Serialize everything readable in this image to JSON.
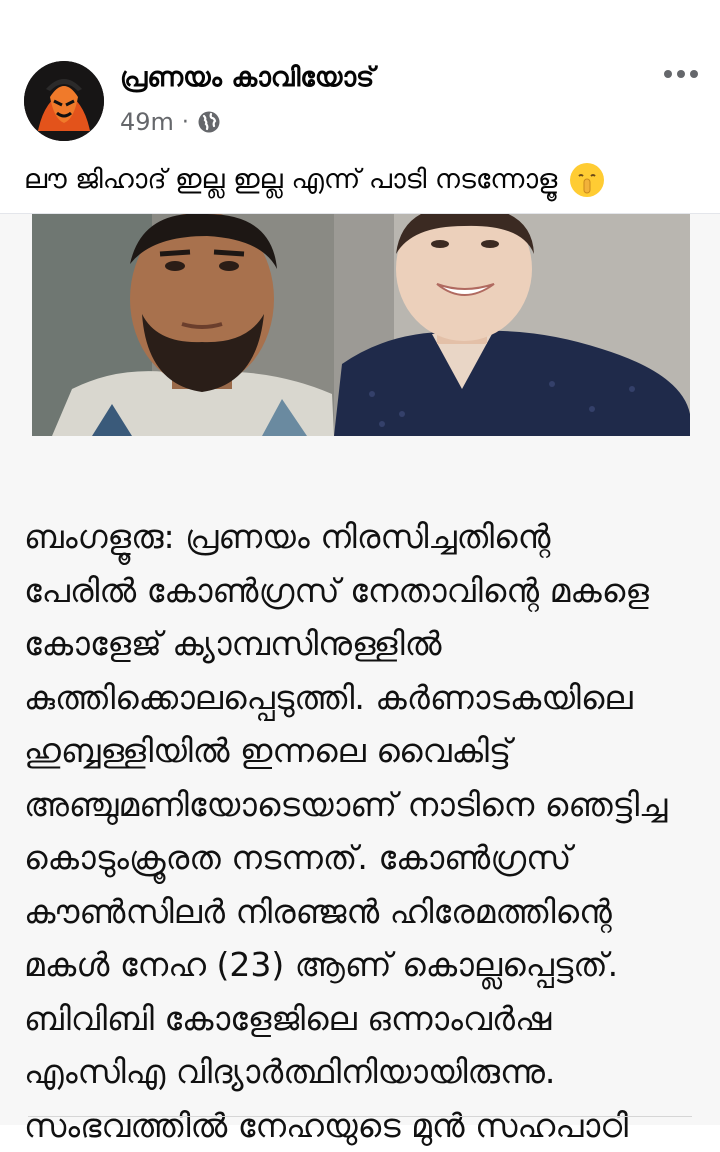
{
  "post": {
    "author": "പ്രണയം കാവിയോട്",
    "time": "49m",
    "separator": "·",
    "privacy_icon": "globe-icon",
    "more_icon": "more-horizontal-icon",
    "caption": "ലൗ ജിഹാദ് ഇല്ല ഇല്ല എന്ന് പാടി നടന്നോളൂ",
    "caption_emoji": "shushing-face-emoji"
  },
  "shared_image": {
    "article_lines": [
      "ബംഗളൂരു: പ്രണയം നിരസിച്ചതിന്റെ",
      "പേരിൽ കോൺഗ്രസ് നേതാവിന്റെ മകളെ",
      "കോളേജ് ക്യാമ്പസിനുള്ളിൽ",
      "കുത്തിക്കൊലപ്പെടുത്തി. കർണാടകയിലെ",
      "ഹുബ്ബള്ളിയിൽ ഇന്നലെ വൈകിട്ട്",
      "അഞ്ചുമണിയോടെയാണ് നാടിനെ ഞെട്ടിച്ച",
      "കൊടുംക്രൂരത നടന്നത്. കോൺഗ്രസ്",
      "കൗൺസിലർ നിരഞ്ജൻ ഹിരേമത്തിന്റെ",
      "മകൾ നേഹ (23) ആണ് കൊല്ലപ്പെട്ടത്.",
      "ബിവിബി കോളേജിലെ ഒന്നാംവർഷ",
      "എംസിഎ വിദ്യാർത്ഥിനിയായിരുന്നു.",
      "സംഭവത്തിൽ നേഹയുടെ മുൻ സഹപാഠി"
    ]
  },
  "colors": {
    "primary_text": "#050505",
    "secondary_text": "#65676b",
    "divider": "#e4e6eb"
  }
}
